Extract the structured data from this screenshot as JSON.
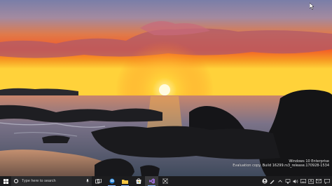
{
  "desktop": {
    "watermark_line1": "Windows 10 Enterprise",
    "watermark_line2": "Evaluation copy. Build 16299.rs3_release.170928-1534"
  },
  "taskbar": {
    "search_placeholder": "Type here to search",
    "pinned_apps": [
      "task-view",
      "edge",
      "file-explorer",
      "store",
      "visual-studio",
      "snipping-tool"
    ],
    "accent_color": "#8ab4f8"
  },
  "colors": {
    "taskbar_bg": "#1c1c1e",
    "search_bg": "#2b2b2d"
  }
}
